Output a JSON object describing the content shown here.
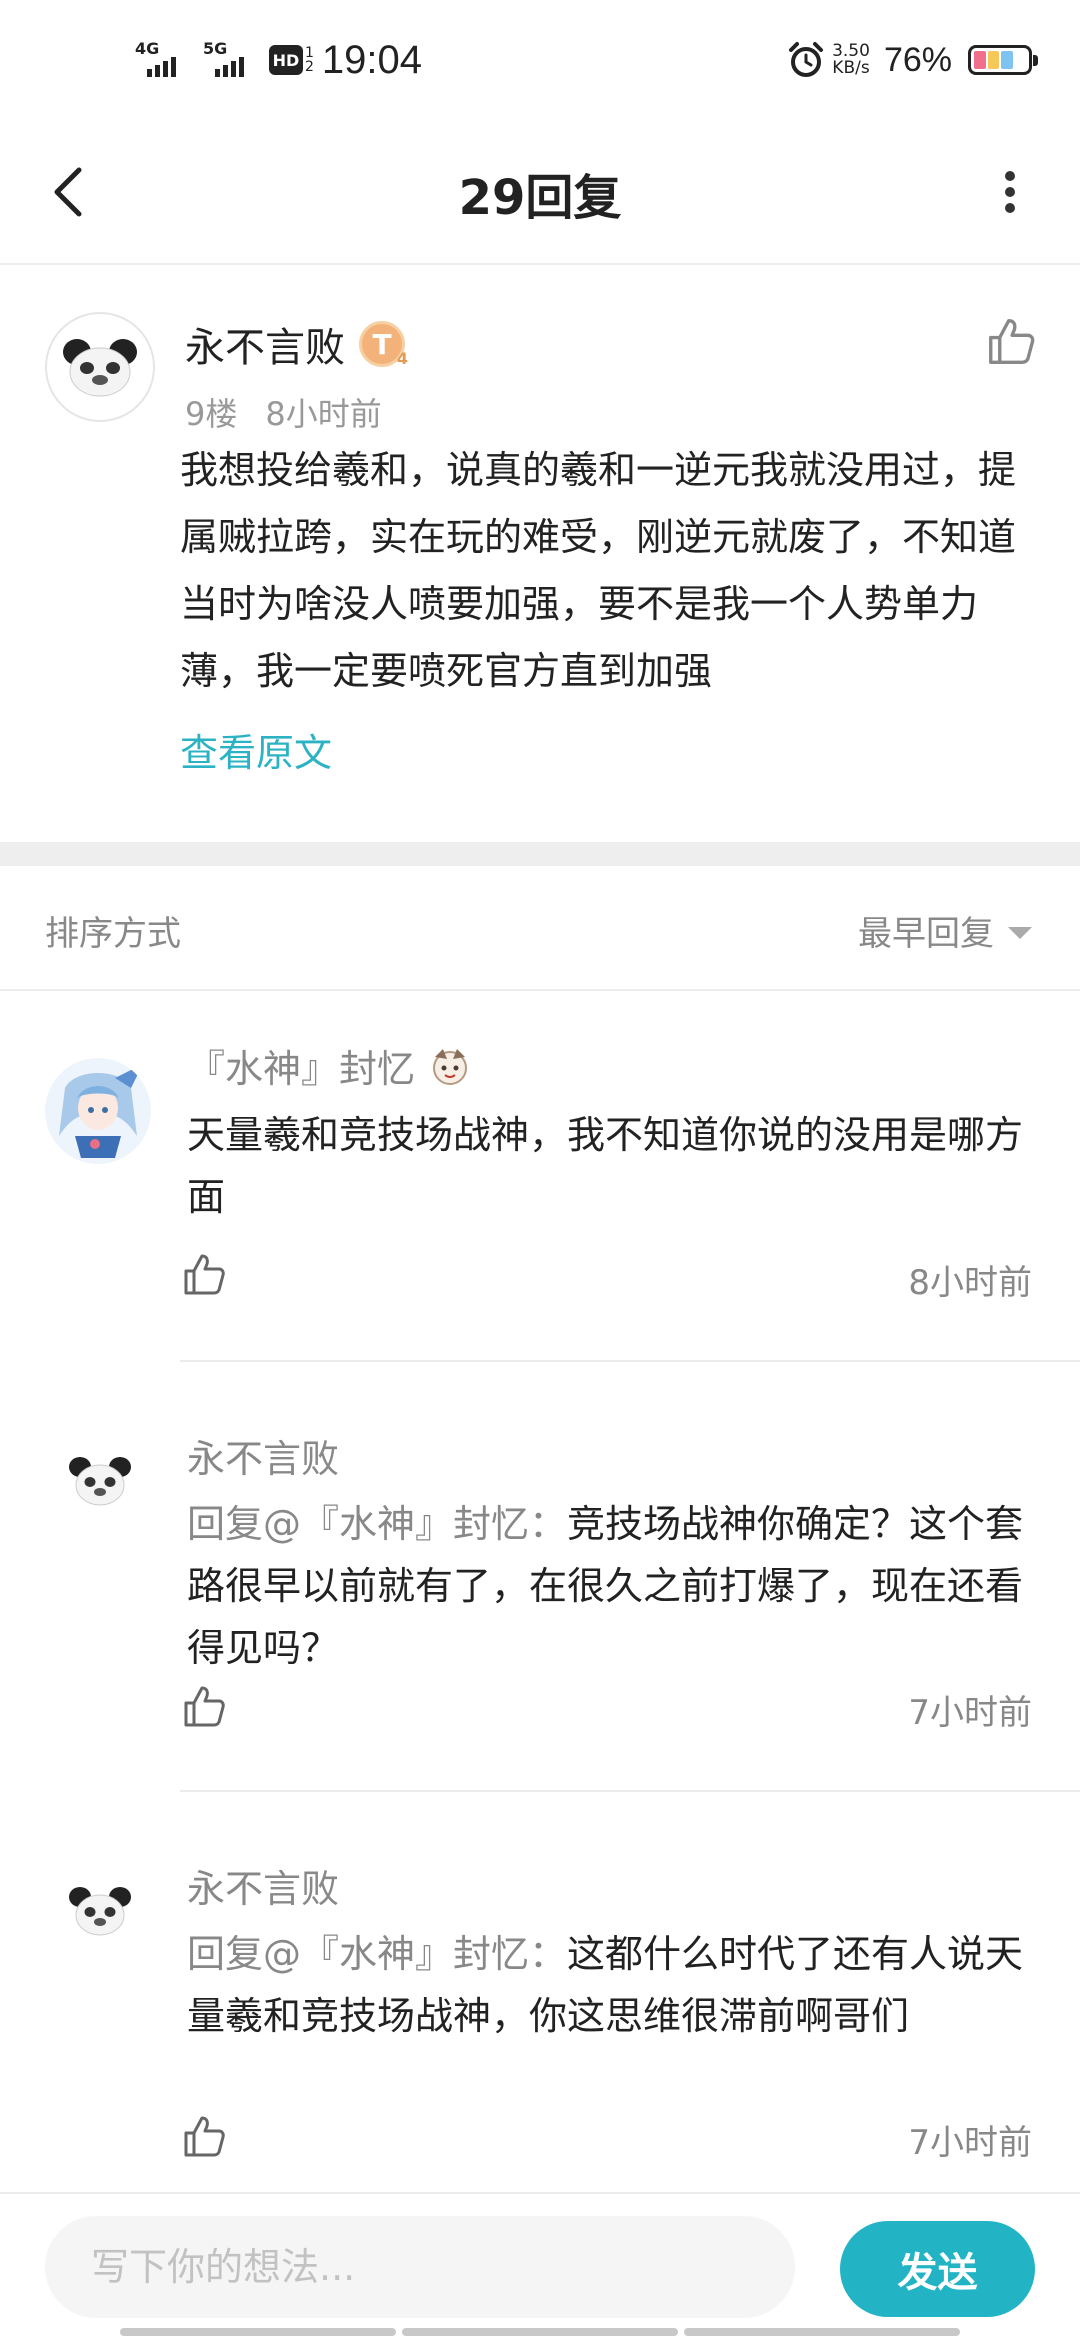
{
  "status_bar": {
    "net1": "4G",
    "net2": "5G",
    "hd": "HD",
    "hd_sub_top": "1",
    "hd_sub_bottom": "2",
    "time": "19:04",
    "speed_value": "3.50",
    "speed_unit": "KB/s",
    "battery_pct": "76%",
    "battery_level": 0.76,
    "battery_colors": [
      "#ef6f8c",
      "#f5c85a",
      "#7fc3f0"
    ]
  },
  "header": {
    "title": "29回复",
    "icons": [
      "back-arrow",
      "more-vertical"
    ]
  },
  "post": {
    "author": "永不言败",
    "badge_letter": "T",
    "badge_level": "4",
    "floor": "9楼",
    "time": "8小时前",
    "content": "我想投给羲和，说真的羲和一逆元我就没用过，提属贼拉跨，实在玩的难受，刚逆元就废了，不知道当时为啥没人喷要加强，要不是我一个人势单力薄，我一定要喷死官方直到加强",
    "view_original": "查看原文"
  },
  "sort": {
    "label": "排序方式",
    "selected": "最早回复"
  },
  "replies": [
    {
      "author": "『水神』封忆",
      "mention": "",
      "text": "天量羲和竞技场战神，我不知道你说的没用是哪方面",
      "time": "8小时前"
    },
    {
      "author": "永不言败",
      "mention": "回复@『水神』封忆：",
      "text": "竞技场战神你确定？这个套路很早以前就有了，在很久之前打爆了，现在还看得见吗？",
      "time": "7小时前"
    },
    {
      "author": "永不言败",
      "mention": "回复@『水神』封忆：",
      "text": "这都什么时代了还有人说天量羲和竞技场战神，你这思维很滞前啊哥们",
      "time": "7小时前"
    }
  ],
  "composer": {
    "placeholder": "写下你的想法...",
    "send": "发送"
  },
  "colors": {
    "accent": "#22b4c4",
    "link": "#2cb3c3",
    "muted": "#888888"
  }
}
